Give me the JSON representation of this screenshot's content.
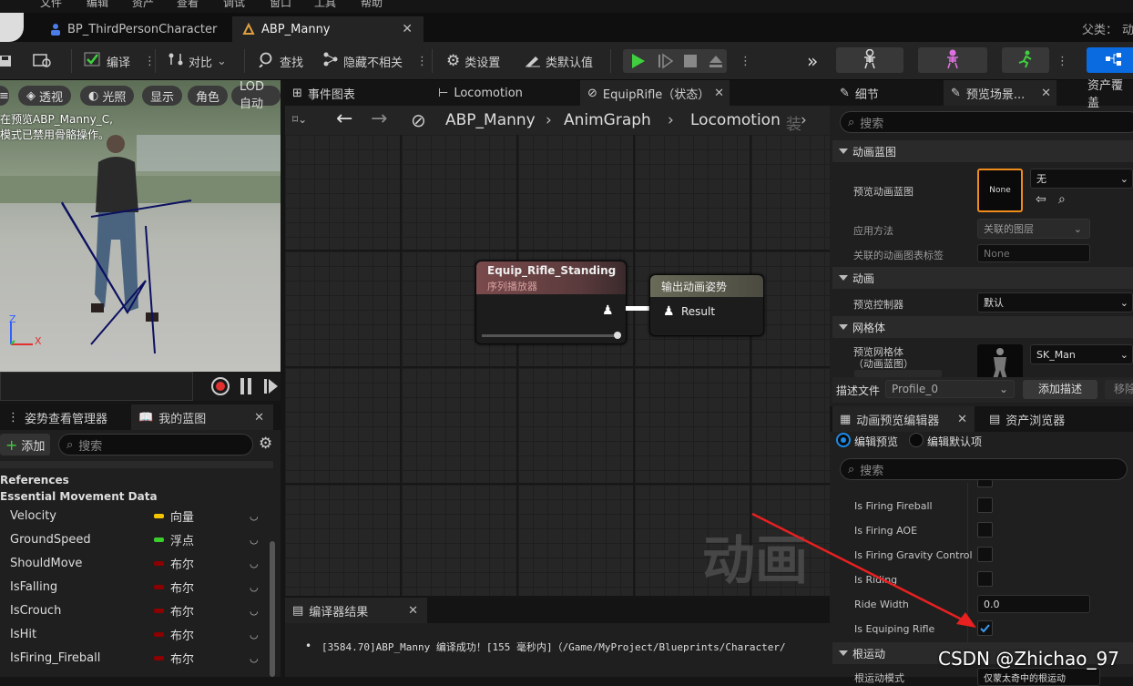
{
  "menu": [
    "文件",
    "编辑",
    "资产",
    "查看",
    "调试",
    "窗口",
    "工具",
    "帮助"
  ],
  "doc_tabs": [
    {
      "label": "BP_ThirdPersonCharacter"
    },
    {
      "label": "ABP_Manny"
    }
  ],
  "parent_class_label": "父类：",
  "parent_class_value": "动",
  "toolbar": {
    "compile": "编译",
    "diff": "对比",
    "find": "查找",
    "hide_unrelated": "隐藏不相关",
    "class_settings": "类设置",
    "class_defaults": "类默认值"
  },
  "viewport": {
    "pills": [
      "透视",
      "光照",
      "显示",
      "角色",
      "LOD自动"
    ],
    "overlay_line1": "在预览ABP_Manny_C,",
    "overlay_line2": "模式已禁用骨骼操作。",
    "axis_x": "X",
    "axis_z": "Z"
  },
  "graph_tabs": [
    "事件图表",
    "Locomotion",
    "EquipRifle（状态）"
  ],
  "breadcrumb": [
    "ABP_Manny",
    "AnimGraph",
    "Locomotion",
    "装"
  ],
  "watermark": "动画",
  "nodes": {
    "seq_title": "Equip_Rifle_Standing",
    "seq_sub": "序列播放器",
    "out_title": "输出动画姿势",
    "out_pin": "Result"
  },
  "compiler": {
    "tab": "编译器结果",
    "message": "[3584.70]ABP_Manny 编译成功！[155 毫秒内]（/Game/MyProject/Blueprints/Character/"
  },
  "bottom_left": {
    "tabs": [
      "姿势查看管理器",
      "我的蓝图"
    ],
    "add_label": "添加",
    "search_placeholder": "搜索",
    "cat1": "References",
    "cat2": "Essential Movement Data",
    "vars": [
      {
        "name": "Velocity",
        "type": "向量",
        "color": "#f5c400"
      },
      {
        "name": "GroundSpeed",
        "type": "浮点",
        "color": "#3bcf2c"
      },
      {
        "name": "ShouldMove",
        "type": "布尔",
        "color": "#8c0000"
      },
      {
        "name": "IsFalling",
        "type": "布尔",
        "color": "#8c0000"
      },
      {
        "name": "IsCrouch",
        "type": "布尔",
        "color": "#8c0000"
      },
      {
        "name": "IsHit",
        "type": "布尔",
        "color": "#8c0000"
      },
      {
        "name": "IsFiring_Fireball",
        "type": "布尔",
        "color": "#8c0000"
      }
    ]
  },
  "details": {
    "tabs": [
      "细节",
      "预览场景...",
      "资产覆盖"
    ],
    "search_placeholder": "搜索",
    "sect_animbp": "动画蓝图",
    "preview_animbp_label": "预览动画蓝图",
    "none_thumb": "None",
    "none_value": "无",
    "apply_method_label": "应用方法",
    "apply_method_value": "关联的图层",
    "linked_tag_label": "关联的动画图表标签",
    "linked_tag_value": "None",
    "sect_anim": "动画",
    "preview_controller_label": "预览控制器",
    "preview_controller_value": "默认",
    "sect_mesh": "网格体",
    "preview_mesh_label1": "预览网格体",
    "preview_mesh_label2": "（动画蓝图）",
    "mesh_value": "SK_Man",
    "profile_label": "描述文件",
    "profile_value": "Profile_0",
    "add_profile": "添加描述",
    "remove_profile": "移除"
  },
  "preview_editor": {
    "tabs": [
      "动画预览编辑器",
      "资产浏览器"
    ],
    "radio_edit_preview": "编辑预览",
    "radio_edit_defaults": "编辑默认项",
    "search_placeholder": "搜索",
    "props": [
      {
        "label": "Is Firing Fireball",
        "checked": false
      },
      {
        "label": "Is Firing AOE",
        "checked": false
      },
      {
        "label": "Is Firing Gravity Control",
        "checked": false
      },
      {
        "label": "Is Riding",
        "checked": false
      }
    ],
    "ride_width_label": "Ride Width",
    "ride_width_value": "0.0",
    "equip_label": "Is Equiping Rifle",
    "equip_checked": true,
    "sect_root": "根运动",
    "root_mode_label": "根运动模式",
    "root_mode_value": "仅蒙太奇中的根运动"
  },
  "credit": "CSDN @Zhichao_97"
}
